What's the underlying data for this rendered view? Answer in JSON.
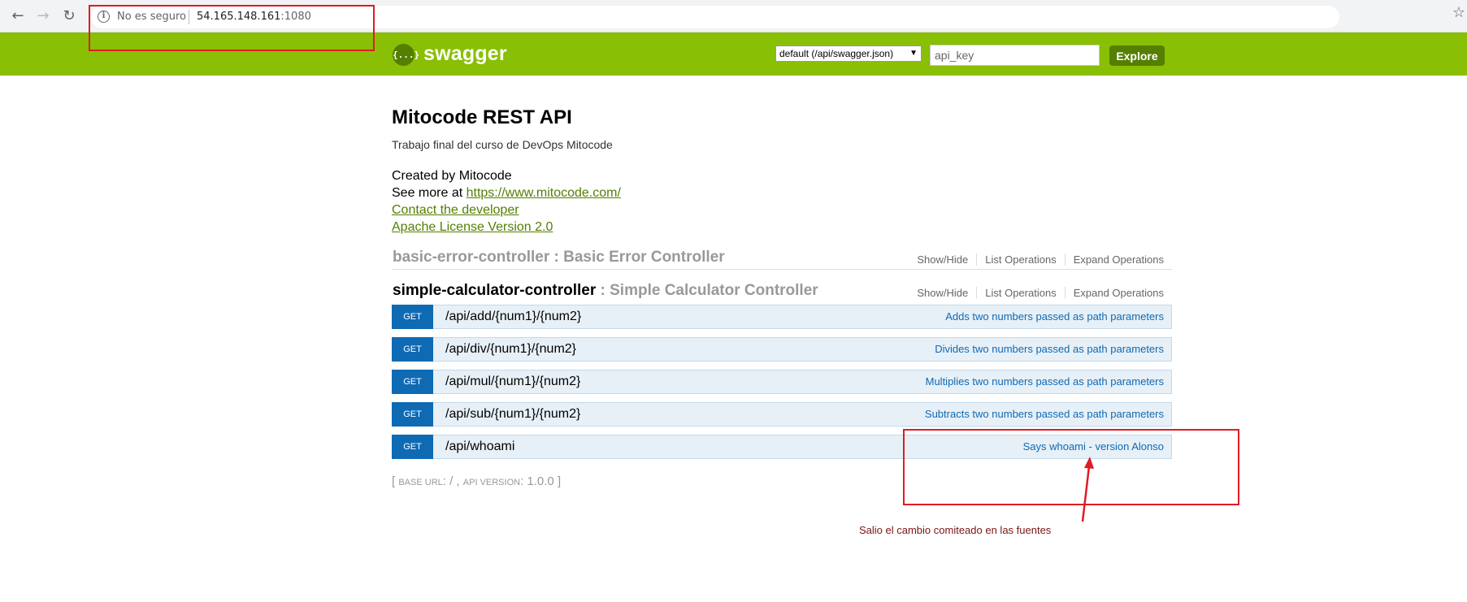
{
  "browser": {
    "back_icon": "←",
    "forward_icon": "→",
    "reload_icon": "↻",
    "security_label": "No es seguro",
    "url_host": "54.165.148.161",
    "url_port": ":1080",
    "star_icon": "☆"
  },
  "header": {
    "logo_glyph": "{...}",
    "logo_text": "swagger",
    "spec_select": "default (/api/swagger.json)",
    "spec_arrow": "▼",
    "api_key_placeholder": "api_key",
    "explore_label": "Explore",
    "background_color": "#89bf04"
  },
  "info": {
    "title": "Mitocode REST API",
    "description": "Trabajo final del curso de DevOps Mitocode",
    "created_by": "Created by Mitocode",
    "see_more_prefix": "See more at ",
    "see_more_link": "https://www.mitocode.com/",
    "contact_link": "Contact the developer",
    "license_link": "Apache License Version 2.0"
  },
  "resources": [
    {
      "name": "basic-error-controller",
      "separator": " : ",
      "description": "Basic Error Controller",
      "show_hide": "Show/Hide",
      "list_ops": "List Operations",
      "expand_ops": "Expand Operations"
    },
    {
      "name": "simple-calculator-controller",
      "separator": " : ",
      "description": "Simple Calculator Controller",
      "show_hide": "Show/Hide",
      "list_ops": "List Operations",
      "expand_ops": "Expand Operations"
    }
  ],
  "operations": [
    {
      "method": "GET",
      "path": "/api/add/{num1}/{num2}",
      "summary": "Adds two numbers passed as path parameters"
    },
    {
      "method": "GET",
      "path": "/api/div/{num1}/{num2}",
      "summary": "Divides two numbers passed as path parameters"
    },
    {
      "method": "GET",
      "path": "/api/mul/{num1}/{num2}",
      "summary": "Multiplies two numbers passed as path parameters"
    },
    {
      "method": "GET",
      "path": "/api/sub/{num1}/{num2}",
      "summary": "Subtracts two numbers passed as path parameters"
    },
    {
      "method": "GET",
      "path": "/api/whoami",
      "summary": "Says whoami - version Alonso"
    }
  ],
  "footer": {
    "open_bracket": "[ ",
    "base_url_label": "base url",
    "base_url_value": ": / , ",
    "api_version_label": "api version",
    "api_version_value": ": 1.0.0",
    "close_bracket": " ]"
  },
  "annotation": {
    "text": "Salio el cambio comiteado en las  fuentes",
    "color": "#e01b24"
  }
}
